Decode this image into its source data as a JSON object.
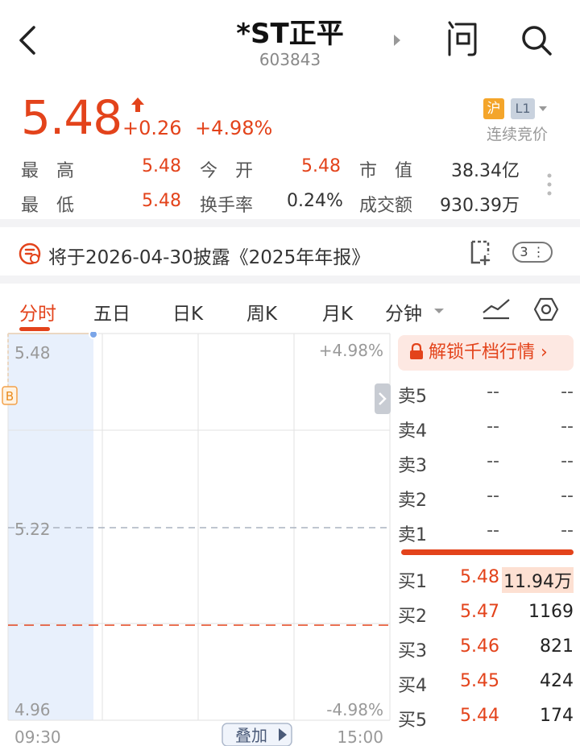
{
  "header": {
    "title": "*ST正平",
    "code": "603843"
  },
  "quote": {
    "price": "5.48",
    "change": "+0.26",
    "change_pct": "+4.98%",
    "market_badge": "沪",
    "level_badge": "L1",
    "status": "连续竞价"
  },
  "stats": [
    {
      "label": "最　高",
      "value": "5.48",
      "color": "red"
    },
    {
      "label": "今　开",
      "value": "5.48",
      "color": "red"
    },
    {
      "label": "市　值",
      "value": "38.34亿",
      "color": "dark"
    },
    {
      "label": "最　低",
      "value": "5.48",
      "color": "red"
    },
    {
      "label": "换手率",
      "value": "0.24%",
      "color": "dark"
    },
    {
      "label": "成交额",
      "value": "930.39万",
      "color": "dark"
    }
  ],
  "notice": {
    "text": "将于2026-04-30披露《2025年年报》",
    "count": "3"
  },
  "tabs": [
    "分时",
    "五日",
    "日K",
    "周K",
    "月K",
    "分钟"
  ],
  "chart": {
    "y_top": "5.48",
    "y_mid": "5.22",
    "y_bottom": "4.96",
    "pct_top": "+4.98%",
    "pct_bottom": "-4.98%",
    "time_start": "09:30",
    "time_end": "15:00",
    "overlay_label": "叠加",
    "marker_label": "B"
  },
  "order_book": {
    "unlock_label": "解锁千档行情",
    "asks": [
      {
        "label": "卖5",
        "price": "--",
        "volume": "--"
      },
      {
        "label": "卖4",
        "price": "--",
        "volume": "--"
      },
      {
        "label": "卖3",
        "price": "--",
        "volume": "--"
      },
      {
        "label": "卖2",
        "price": "--",
        "volume": "--"
      },
      {
        "label": "卖1",
        "price": "--",
        "volume": "--"
      }
    ],
    "bids": [
      {
        "label": "买1",
        "price": "5.48",
        "volume": "11.94万"
      },
      {
        "label": "买2",
        "price": "5.47",
        "volume": "1169"
      },
      {
        "label": "买3",
        "price": "5.46",
        "volume": "821"
      },
      {
        "label": "买4",
        "price": "5.45",
        "volume": "424"
      },
      {
        "label": "买5",
        "price": "5.44",
        "volume": "174"
      }
    ]
  },
  "colors": {
    "up": "#e3431b",
    "badge_hu": "#f4a52a",
    "chart_fill": "#e8f0fc"
  },
  "icons": [
    "back-icon",
    "next-icon",
    "ask-icon",
    "search-icon",
    "up-arrow-icon",
    "more-icon",
    "notice-icon",
    "document-icon",
    "trend-icon",
    "settings-icon",
    "lock-icon",
    "chevron-right-icon"
  ]
}
